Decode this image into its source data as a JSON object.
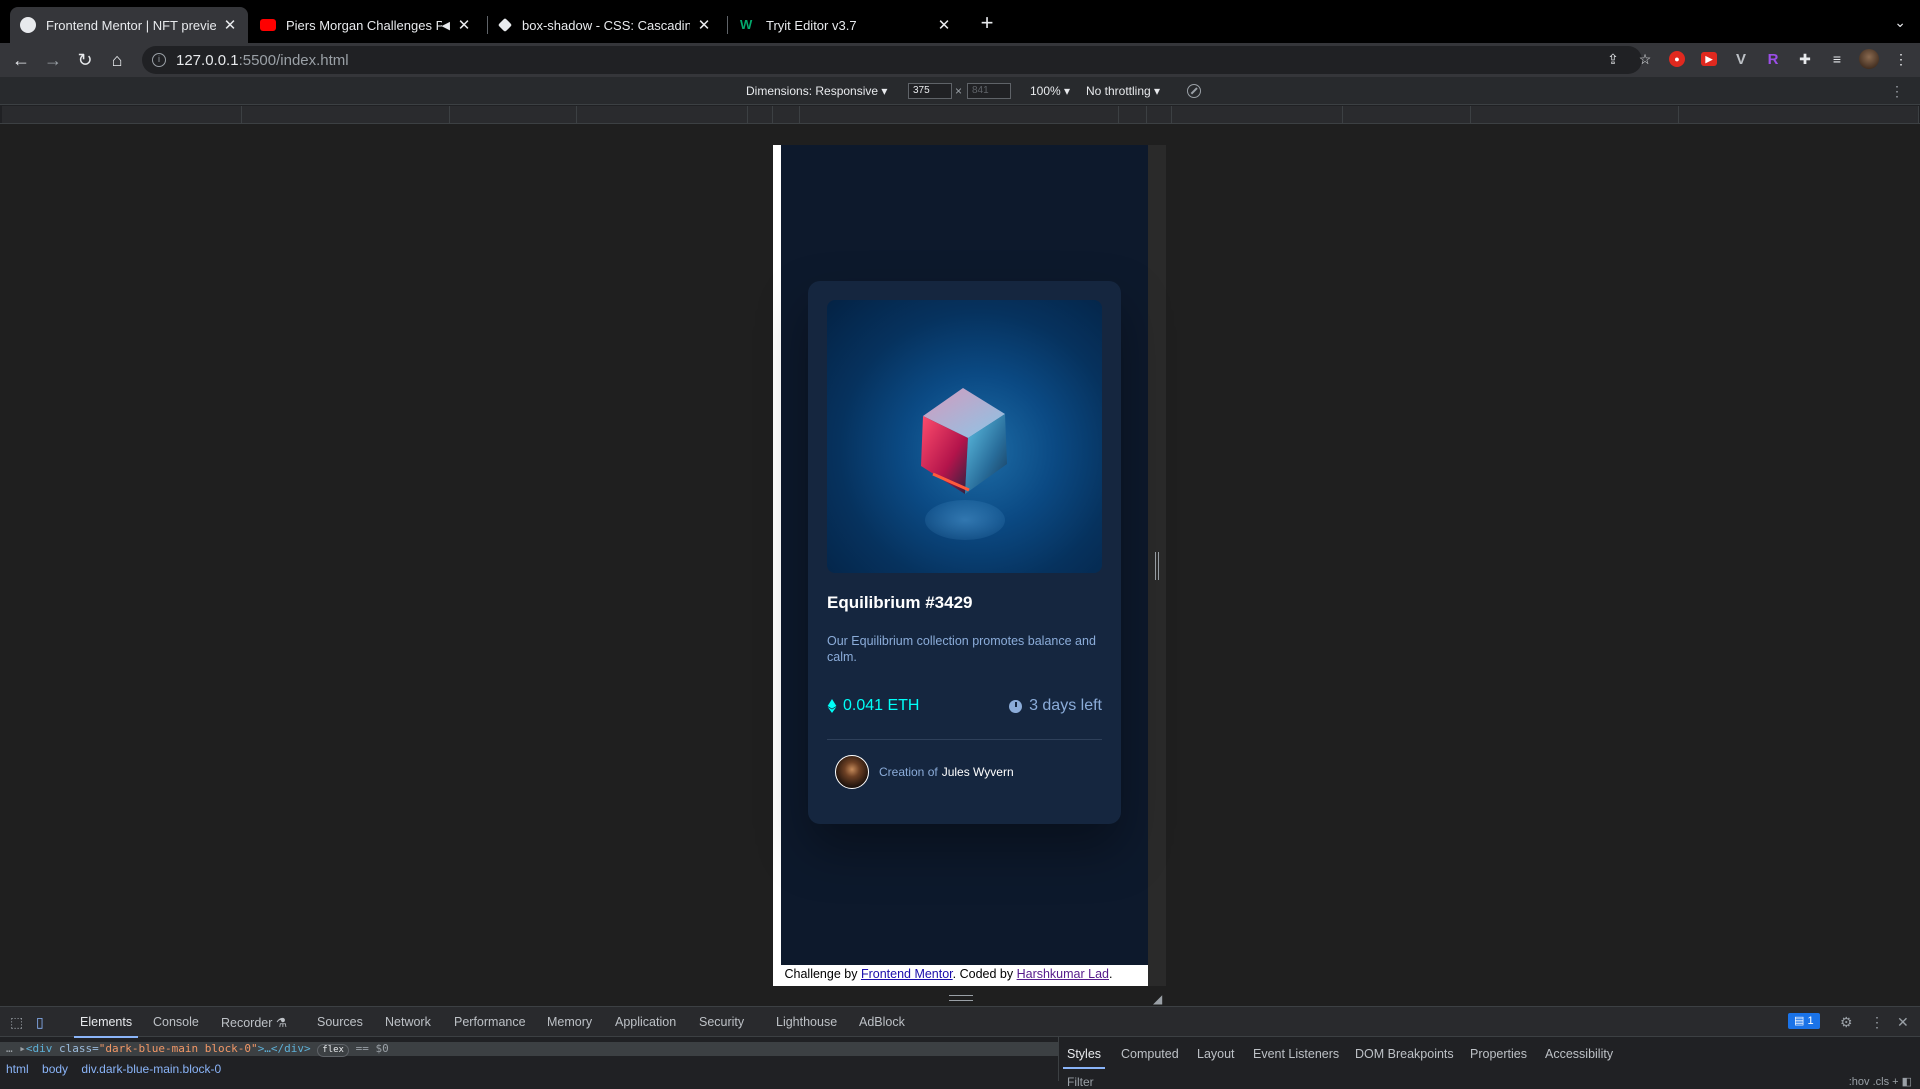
{
  "browser": {
    "tabs": [
      {
        "title": "Frontend Mentor | NFT preview",
        "active": true
      },
      {
        "title": "Piers Morgan Challenges P",
        "active": false
      },
      {
        "title": "box-shadow - CSS: Cascading",
        "active": false
      },
      {
        "title": "Tryit Editor v3.7",
        "active": false
      }
    ],
    "url_host": "127.0.0.1",
    "url_path": ":5500/index.html"
  },
  "device_toolbar": {
    "dimensions_label": "Dimensions: Responsive ▾",
    "width_value": "375",
    "height_value": "841",
    "times": "×",
    "zoom": "100% ▾",
    "throttling": "No throttling ▾"
  },
  "nft": {
    "title": "Equilibrium #3429",
    "description": "Our Equilibrium collection promotes balance and calm.",
    "price": "0.041 ETH",
    "time_left": "3 days left",
    "creator_prefix": "Creation of",
    "creator_name": "Jules Wyvern"
  },
  "attribution": {
    "pre": "Challenge by ",
    "link1": "Frontend Mentor",
    "mid": ". Coded by ",
    "link2": "Harshkumar Lad",
    "post": "."
  },
  "devtools": {
    "tabs": [
      "Elements",
      "Console",
      "Recorder ⚗",
      "Sources",
      "Network",
      "Performance",
      "Memory",
      "Application",
      "Security",
      "Lighthouse",
      "AdBlock"
    ],
    "issues_count": "1",
    "dom_line": {
      "prefix": "…  ▸",
      "tag_open": "<div",
      "attr": " class=",
      "value": "\"dark-blue-main block-0\"",
      "tag_close": ">…</div>",
      "badge": "flex",
      "suffix": " == $0"
    },
    "breadcrumbs": [
      "html",
      "body",
      "div.dark-blue-main.block-0"
    ],
    "side_tabs": [
      "Styles",
      "Computed",
      "Layout",
      "Event Listeners",
      "DOM Breakpoints",
      "Properties",
      "Accessibility"
    ],
    "filter_placeholder": "Filter",
    "filter_right": ":hov  .cls  +  ◧"
  },
  "colors": {
    "card_bg": "#15263f",
    "main_bg": "#0d192c",
    "cyan": "#00fff8",
    "soft_blue": "#8bacd9"
  }
}
